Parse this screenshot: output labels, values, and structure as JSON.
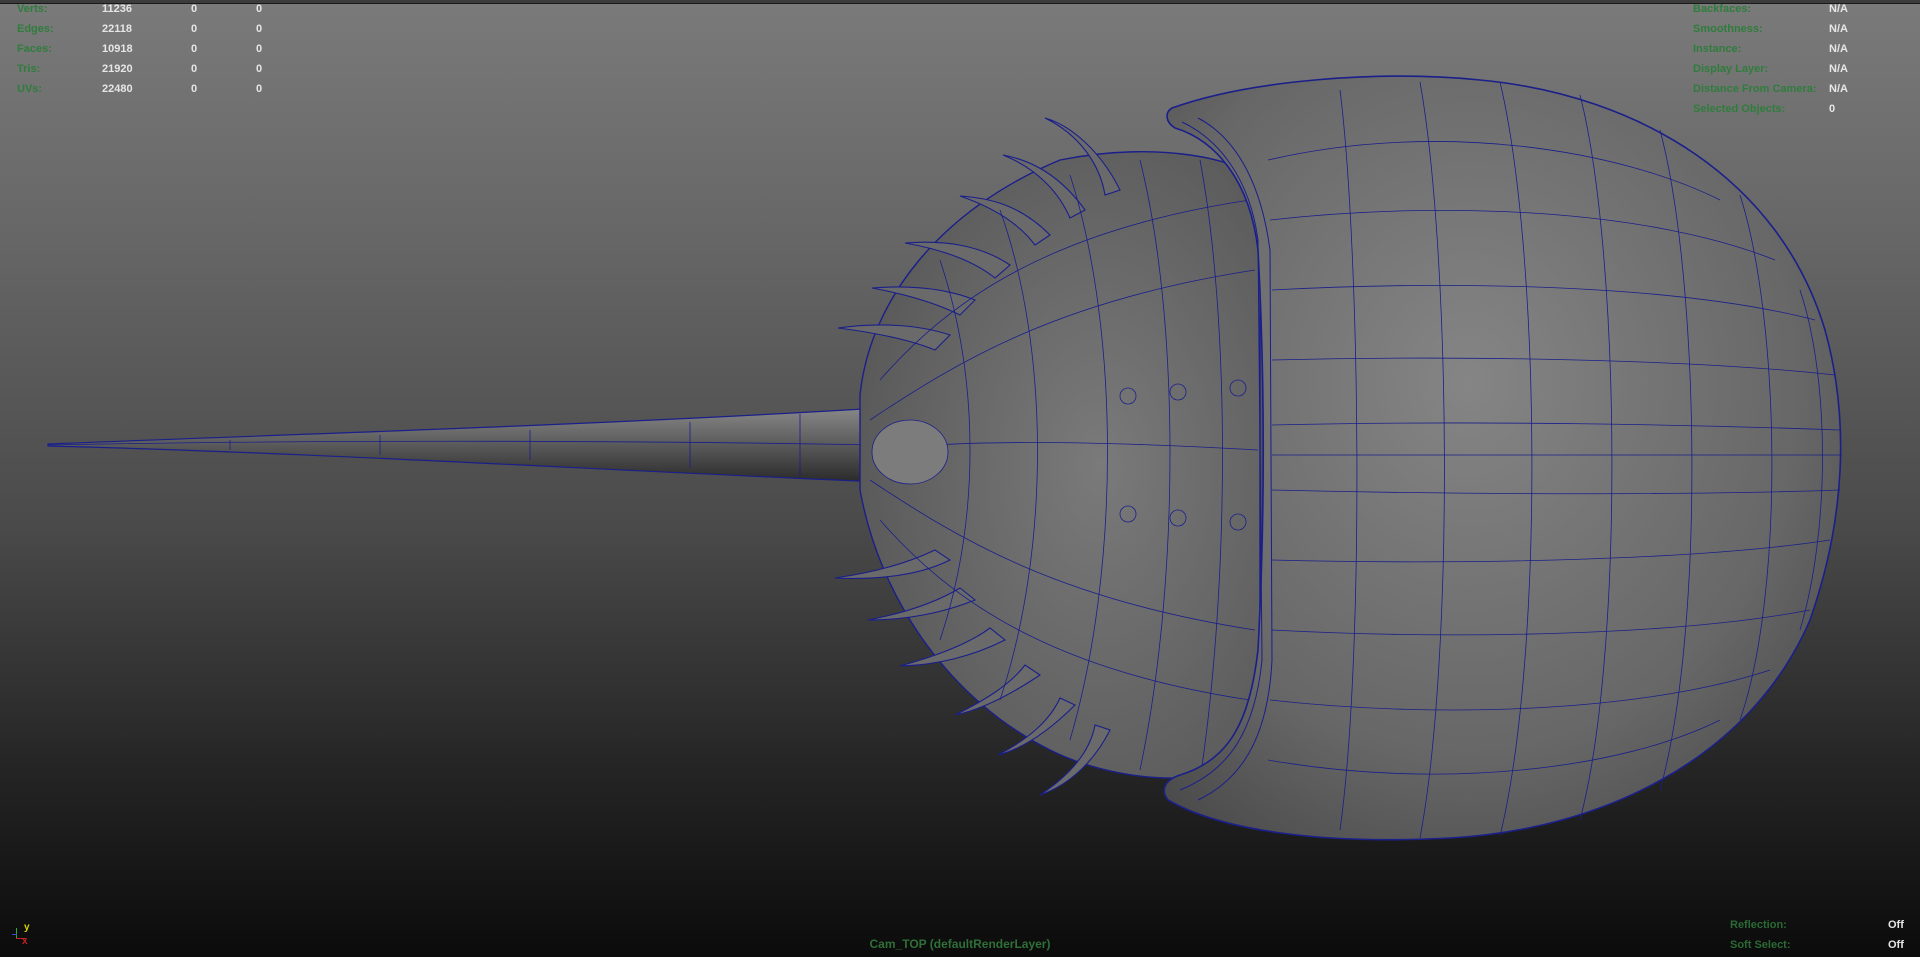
{
  "stats": [
    {
      "label": "Verts:",
      "v1": "11236",
      "v2": "0",
      "v3": "0"
    },
    {
      "label": "Edges:",
      "v1": "22118",
      "v2": "0",
      "v3": "0"
    },
    {
      "label": "Faces:",
      "v1": "10918",
      "v2": "0",
      "v3": "0"
    },
    {
      "label": "Tris:",
      "v1": "21920",
      "v2": "0",
      "v3": "0"
    },
    {
      "label": "UVs:",
      "v1": "22480",
      "v2": "0",
      "v3": "0"
    }
  ],
  "info": [
    {
      "label": "Backfaces:",
      "value": "N/A"
    },
    {
      "label": "Smoothness:",
      "value": "N/A"
    },
    {
      "label": "Instance:",
      "value": "N/A"
    },
    {
      "label": "Display Layer:",
      "value": "N/A"
    },
    {
      "label": "Distance From Camera:",
      "value": "N/A"
    },
    {
      "label": "Selected Objects:",
      "value": "0"
    }
  ],
  "bottom_right": [
    {
      "label": "Reflection:",
      "value": "Off"
    },
    {
      "label": "Soft Select:",
      "value": "Off"
    }
  ],
  "camera_label": "Cam_TOP (defaultRenderLayer)",
  "axis": {
    "y": "y",
    "x": "x"
  },
  "colors": {
    "hud_label": "#2f7d3c",
    "wireframe": "#1a1f8a",
    "mesh_fill": "#6e6e6e"
  }
}
